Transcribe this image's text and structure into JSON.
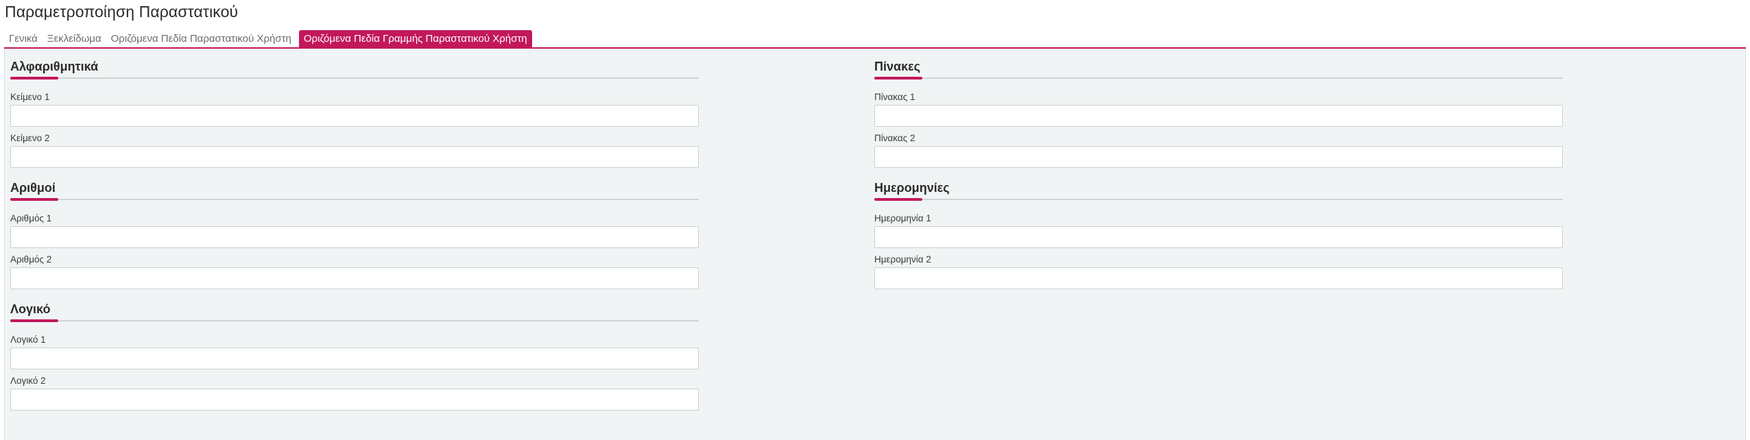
{
  "page": {
    "title": "Παραμετροποίηση Παραστατικού"
  },
  "tabs": [
    {
      "label": "Γενικά",
      "active": false
    },
    {
      "label": "Ξεκλείδωμα",
      "active": false
    },
    {
      "label": "Οριζόμενα Πεδία Παραστατικού Χρήστη",
      "active": false
    },
    {
      "label": "Οριζόμενα Πεδία Γραμμής Παραστατικού Χρήστη",
      "active": true
    }
  ],
  "sections": {
    "alphanumeric": {
      "title": "Αλφαριθμητικά",
      "fields": [
        {
          "label": "Κείμενο 1",
          "value": ""
        },
        {
          "label": "Κείμενο 2",
          "value": ""
        }
      ]
    },
    "numbers": {
      "title": "Αριθμοί",
      "fields": [
        {
          "label": "Αριθμός 1",
          "value": ""
        },
        {
          "label": "Αριθμός 2",
          "value": ""
        }
      ]
    },
    "boolean": {
      "title": "Λογικό",
      "fields": [
        {
          "label": "Λογικό 1",
          "value": ""
        },
        {
          "label": "Λογικό 2",
          "value": ""
        }
      ]
    },
    "tables": {
      "title": "Πίνακες",
      "fields": [
        {
          "label": "Πίνακας 1",
          "value": ""
        },
        {
          "label": "Πίνακας 2",
          "value": ""
        }
      ]
    },
    "dates": {
      "title": "Ημερομηνίες",
      "fields": [
        {
          "label": "Ημερομηνία 1",
          "value": ""
        },
        {
          "label": "Ημερομηνία 2",
          "value": ""
        }
      ]
    }
  },
  "colors": {
    "accent": "#c2185b",
    "panel_background": "#f1f4f4"
  }
}
